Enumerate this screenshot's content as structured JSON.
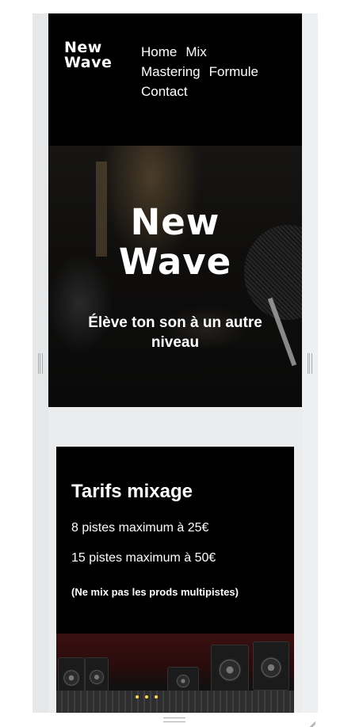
{
  "header": {
    "logo_line1": "New",
    "logo_line2": "Wave",
    "nav": [
      "Home",
      "Mix",
      "Mastering",
      "Formule",
      "Contact"
    ]
  },
  "hero": {
    "title_line1": "New",
    "title_line2": "Wave",
    "subtitle": "Élève ton son à un autre niveau"
  },
  "pricing": {
    "title": "Tarifs mixage",
    "line1": "8 pistes maximum à 25€",
    "line2": "15 pistes maximum à 50€",
    "note": "(Ne mix pas les prods multipistes)"
  },
  "colors": {
    "header_bg": "#000000",
    "page_bg": "#ebeced",
    "text": "#ffffff"
  }
}
